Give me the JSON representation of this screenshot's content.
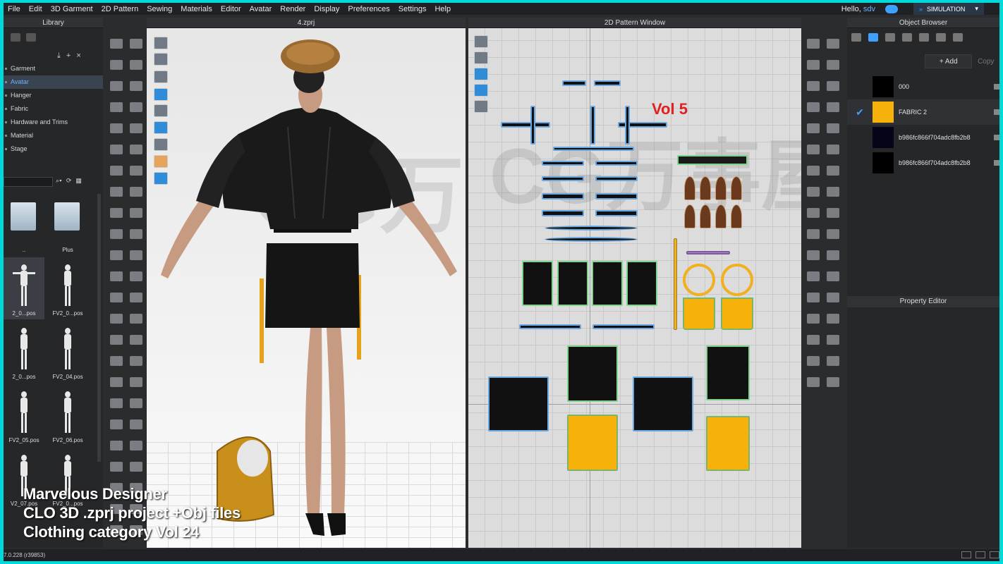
{
  "menu": [
    "File",
    "Edit",
    "3D Garment",
    "2D Pattern",
    "Sewing",
    "Materials",
    "Editor",
    "Avatar",
    "Render",
    "Display",
    "Preferences",
    "Settings",
    "Help"
  ],
  "user": {
    "greeting": "Hello,",
    "name": "sdv"
  },
  "simulation_label": "SIMULATION",
  "library": {
    "title": "Library",
    "tree": [
      "Garment",
      "Avatar",
      "Hanger",
      "Fabric",
      "Hardware and Trims",
      "Material",
      "Stage"
    ],
    "selected": "Avatar",
    "items": [
      {
        "label": "..",
        "kind": "folder"
      },
      {
        "label": "Plus",
        "kind": "folder"
      },
      {
        "label": "2_0...pos",
        "kind": "pose"
      },
      {
        "label": "FV2_0...pos",
        "kind": "pose"
      },
      {
        "label": "2_0...pos",
        "kind": "pose"
      },
      {
        "label": "FV2_04.pos",
        "kind": "pose"
      },
      {
        "label": "FV2_05.pos",
        "kind": "pose"
      },
      {
        "label": "FV2_06.pos",
        "kind": "pose"
      },
      {
        "label": "V2_07.pos",
        "kind": "pose"
      },
      {
        "label": "FV2_0...pos",
        "kind": "pose"
      }
    ]
  },
  "view3d": {
    "title": "4.zprj"
  },
  "view2d": {
    "title": "2D Pattern Window",
    "annotation": "Vol 5"
  },
  "object_browser": {
    "title": "Object Browser",
    "add_label": "+ Add",
    "copy_label": "Copy",
    "fabrics": [
      {
        "name": "000",
        "color": "#000000",
        "selected": false
      },
      {
        "name": "FABRIC 2",
        "color": "#f6b20b",
        "selected": true
      },
      {
        "name": "b986fc866f704adc8fb2b8",
        "color": "#05051a",
        "selected": false
      },
      {
        "name": "b986fc866f704adc8fb2b8",
        "color": "#000000",
        "selected": false
      }
    ]
  },
  "property_editor": {
    "title": "Property Editor"
  },
  "status": {
    "version": "7.0.228 (r39853)"
  },
  "overlay": {
    "line1": "Marvelous Designer",
    "line2": "CLO 3D .zprj project +Obj files",
    "line3": "Clothing category Vol 24"
  },
  "colors": {
    "accent": "#3ea0ff",
    "fabric_yellow": "#f6b20b",
    "annotation_red": "#e02020",
    "frame": "#00d9d9"
  }
}
